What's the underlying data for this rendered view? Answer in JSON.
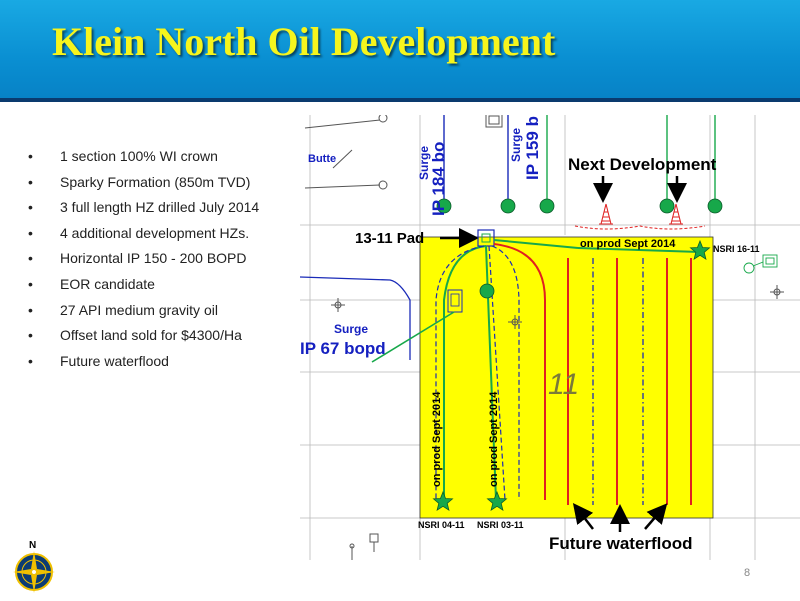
{
  "slide": {
    "title": "Klein North Oil Development",
    "page_number": "8",
    "bullets": [
      "1 section 100% WI crown",
      "Sparky Formation (850m TVD)",
      "3  full length HZ drilled July 2014",
      "4 additional development HZs.",
      "Horizontal IP 150 - 200  BOPD",
      "EOR candidate",
      "27 API medium gravity oil",
      "Offset land sold for $4300/Ha",
      "Future waterflood"
    ]
  },
  "map": {
    "labels": {
      "butte": "Butte",
      "surge_1": "Surge",
      "ip_1": "IP 184 bo",
      "surge_2": "Surge",
      "ip_2": "IP 159 b",
      "next_development": "Next Development",
      "pad": "13-11 Pad",
      "on_prod_top": "on prod Sept 2014",
      "surge_3": "Surge",
      "ip_3": "IP 67 bopd",
      "section_number": "11",
      "on_prod_left_1": "on prod Sept 2014",
      "on_prod_left_2": "on prod Sept 2014",
      "nsri_1": "NSRI 04-11",
      "nsri_2": "NSRI 03-11",
      "nsri_3": "NSRI 16-11",
      "future_waterflood": "Future waterflood",
      "compass_north": "N"
    },
    "colors": {
      "section": "#ffff00",
      "producer": "#17a84a",
      "planned_well": "#e02020",
      "injector": "#1a2bb8",
      "label_blue": "#1520c0"
    }
  }
}
